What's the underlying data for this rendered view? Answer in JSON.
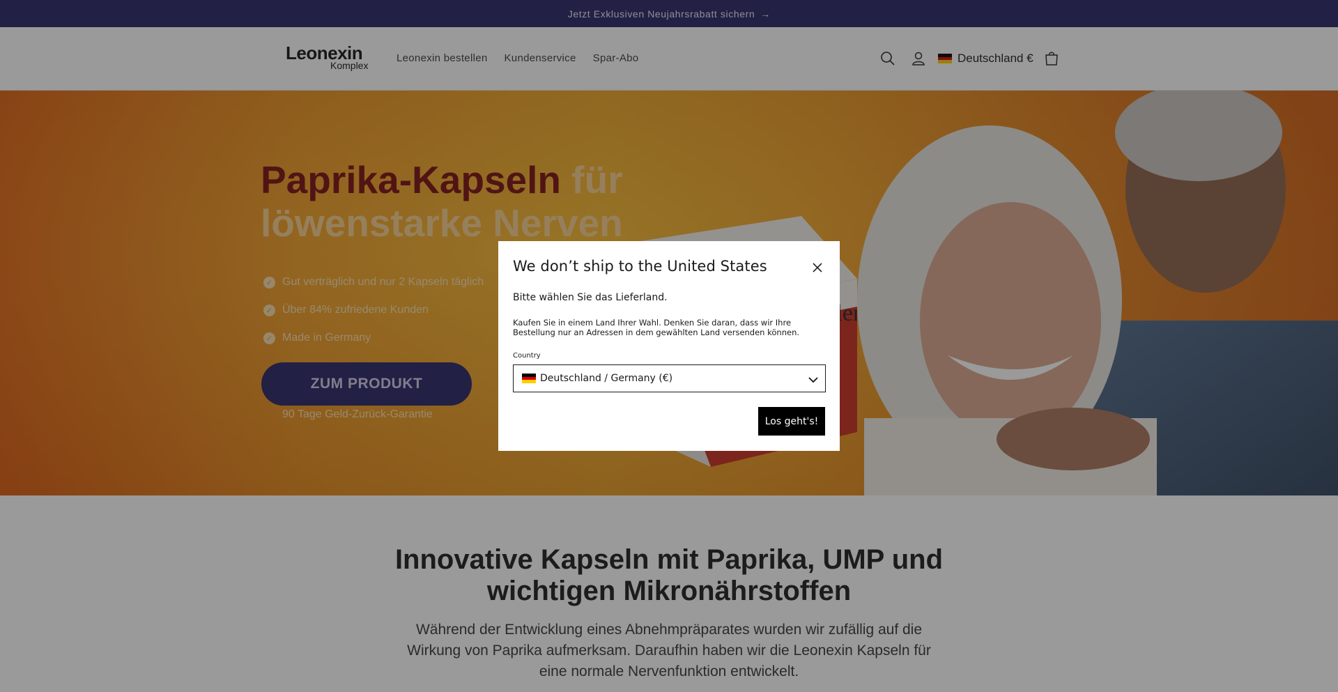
{
  "announcement": {
    "text": "Jetzt Exklusiven Neujahrsrabatt sichern",
    "arrow": "→"
  },
  "header": {
    "logo_main": "Leonexin",
    "logo_sub": "Komplex",
    "nav": [
      {
        "label": "Leonexin bestellen"
      },
      {
        "label": "Kundenservice"
      },
      {
        "label": "Spar-Abo"
      }
    ],
    "icons": [
      "search-icon",
      "account-icon",
      "cart-icon"
    ],
    "country": "Deutschland €"
  },
  "hero": {
    "title_part1": "Paprika-Kapseln",
    "title_part2": " für",
    "title_line2": "löwenstarke Nerven",
    "benefits": [
      {
        "text": "Gut verträglich und nur 2 Kapseln täglich"
      },
      {
        "text": "Über 84% zufriedene Kunden"
      },
      {
        "text": "Made in Germany"
      }
    ],
    "cta": "ZUM PRODUKT",
    "guarantee": "90 Tage Geld-Zurück-Garantie",
    "colors": {
      "title_dark": "#7a0b0b",
      "title_light": "#f8cf8e",
      "cta_bg": "#262263"
    }
  },
  "modal": {
    "title": "We don’t ship to the United States",
    "subtitle": "Bitte wählen Sie das Lieferland.",
    "description": "Kaufen Sie in einem Land Ihrer Wahl. Denken Sie daran, dass wir Ihre Bestellung nur an Adressen in dem gewählten Land versenden können.",
    "country_label": "Country",
    "country_value": "Deutschland / Germany (€)",
    "button": "Los geht's!"
  },
  "section": {
    "heading_line1": "Innovative Kapseln mit Paprika, UMP und",
    "heading_line2": "wichtigen Mikronährstoffen",
    "body": "Während der Entwicklung eines Abnehmpräparates wurden wir zufällig auf die Wirkung von Paprika aufmerksam. Daraufhin haben wir die Leonexin Kapseln für eine normale Nervenfunktion entwickelt."
  },
  "colors": {
    "brand": "#262263",
    "accent_orange": "#f39a1b"
  }
}
